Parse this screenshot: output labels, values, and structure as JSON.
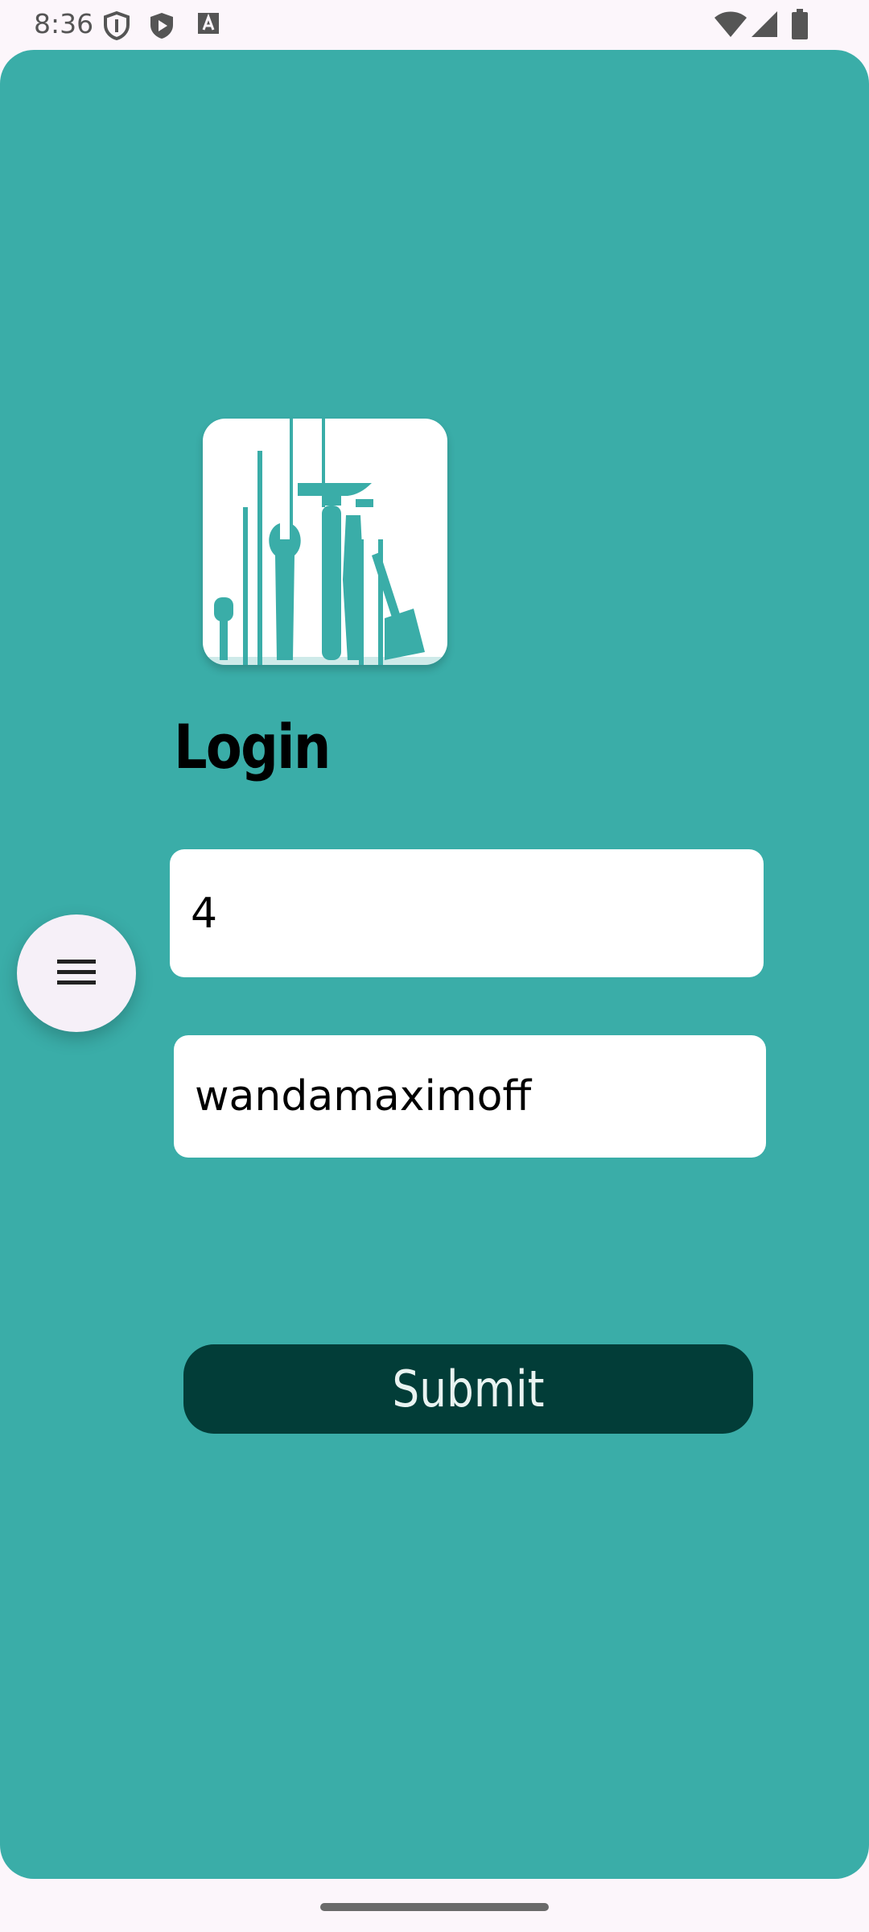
{
  "status_bar": {
    "time": "8:36",
    "icons": [
      "shield-icon",
      "play-store-icon",
      "font-icon",
      "wifi-icon",
      "signal-icon",
      "battery-icon"
    ]
  },
  "login": {
    "title": "Login",
    "username_value": "4",
    "password_value": "wandamaximoff",
    "submit_label": "Submit"
  },
  "menu_fab": {
    "icon": "hamburger-menu-icon"
  },
  "colors": {
    "app_background": "#3AADA8",
    "submit_button": "#023D38",
    "status_bar": "#FCF6FB"
  }
}
